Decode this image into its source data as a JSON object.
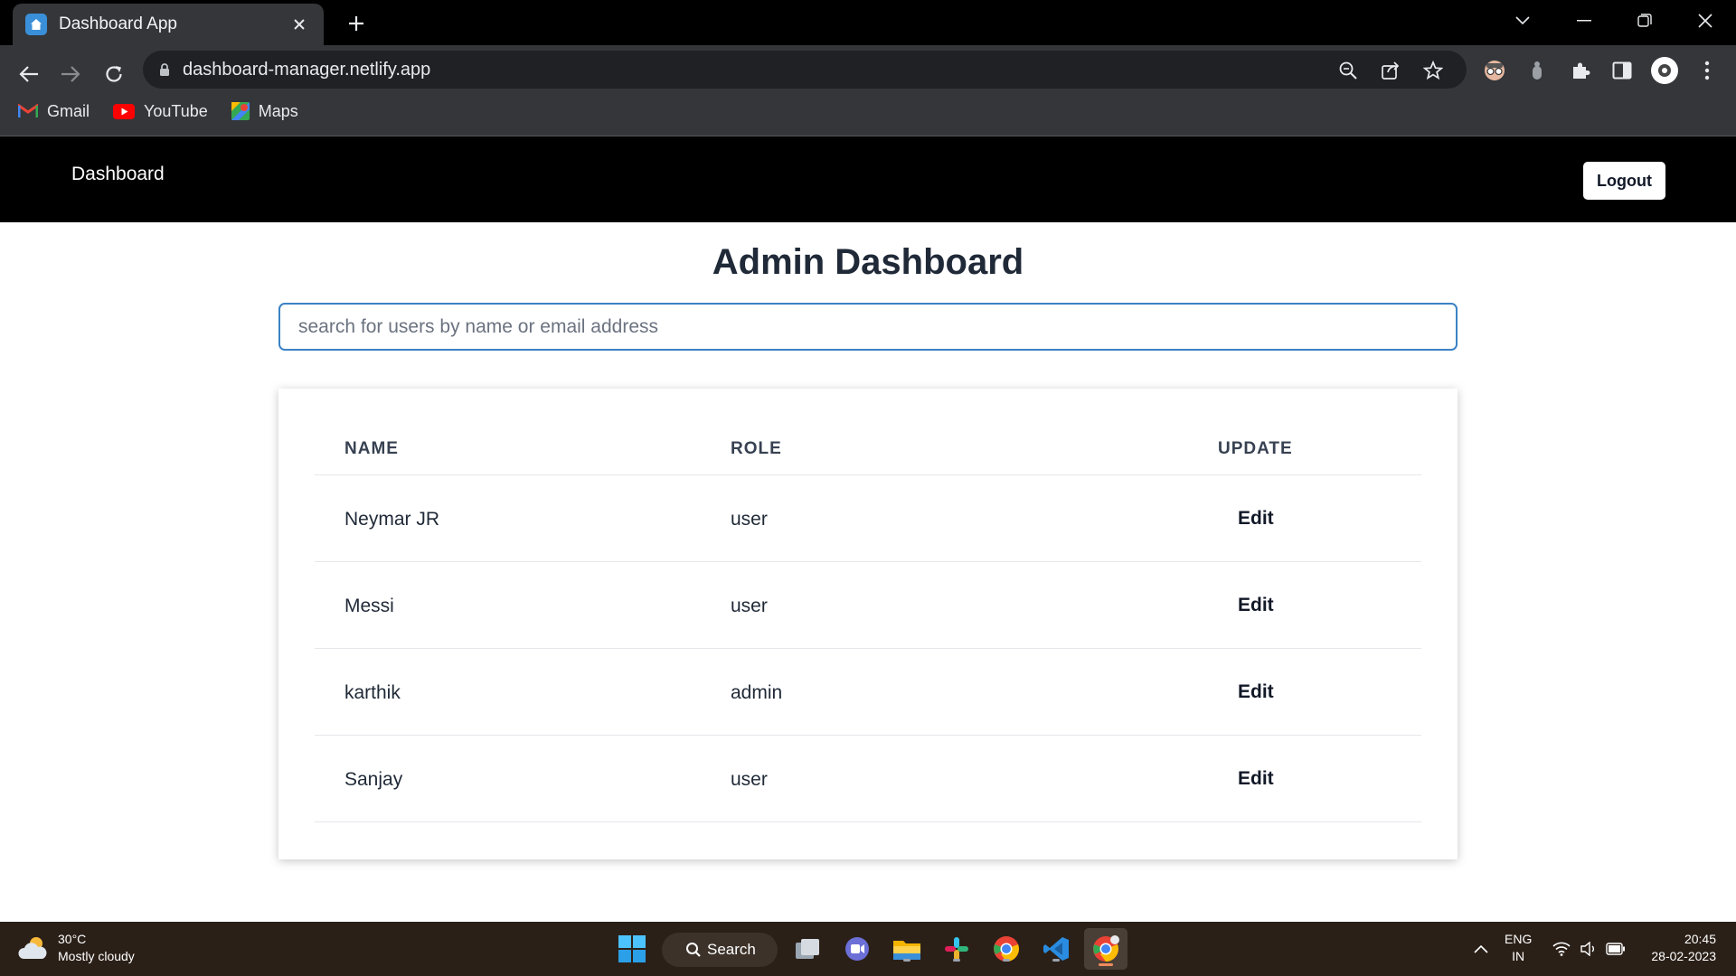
{
  "browser": {
    "tab_title": "Dashboard App",
    "url": "dashboard-manager.netlify.app",
    "bookmarks": [
      {
        "label": "Gmail",
        "icon": "gmail-icon"
      },
      {
        "label": "YouTube",
        "icon": "youtube-icon"
      },
      {
        "label": "Maps",
        "icon": "maps-icon"
      }
    ]
  },
  "app": {
    "brand": "Dashboard",
    "logout_label": "Logout",
    "title": "Admin Dashboard",
    "search_placeholder": "search for users by name or email address",
    "table": {
      "headers": [
        "NAME",
        "ROLE",
        "UPDATE"
      ],
      "rows": [
        {
          "name": "Neymar JR",
          "role": "user",
          "action": "Edit"
        },
        {
          "name": "Messi",
          "role": "user",
          "action": "Edit"
        },
        {
          "name": "karthik",
          "role": "admin",
          "action": "Edit"
        },
        {
          "name": "Sanjay",
          "role": "user",
          "action": "Edit"
        }
      ]
    }
  },
  "taskbar": {
    "weather_temp": "30°C",
    "weather_desc": "Mostly cloudy",
    "search_label": "Search",
    "lang_line1": "ENG",
    "lang_line2": "IN",
    "time": "20:45",
    "date": "28-02-2023"
  },
  "colors": {
    "nav_bg": "#000000",
    "accent": "#3b82c4",
    "text_dark": "#1f2937"
  }
}
